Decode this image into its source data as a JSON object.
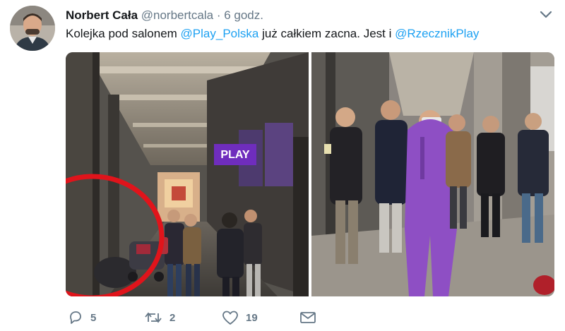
{
  "tweet": {
    "author_name": "Norbert Cała",
    "author_handle": "@norbertcala",
    "separator": "·",
    "time": "6 godz.",
    "text_parts": {
      "t1": "Kolejka pod salonem ",
      "m1": "@Play_Polska",
      "t2": " już całkiem zacna. Jest i ",
      "m2": "@RzecznikPlay"
    },
    "media": {
      "left_photo": {
        "storefront_sign": "PLAY"
      }
    }
  },
  "actions": {
    "reply_count": "5",
    "retweet_count": "2",
    "like_count": "19"
  },
  "colors": {
    "accent": "#1da1f2",
    "text": "#14171a",
    "muted": "#657786",
    "annotation_circle": "#e0141b",
    "purple_onesie": "#8e4fc4",
    "play_purple": "#6f2dbd"
  },
  "icons": [
    "caret-down-icon",
    "reply-icon",
    "retweet-icon",
    "like-icon",
    "message-icon"
  ]
}
